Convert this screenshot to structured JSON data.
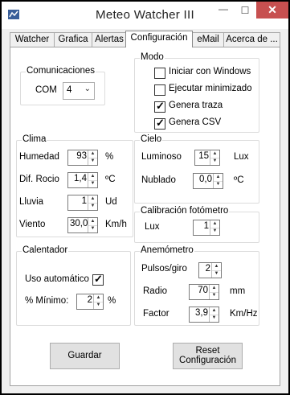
{
  "window": {
    "title": "Meteo Watcher III"
  },
  "tabs": [
    "Watcher",
    "Grafica",
    "Alertas",
    "Configuración",
    "eMail",
    "Acerca de ..."
  ],
  "comunicaciones": {
    "title": "Comunicaciones",
    "label": "COM",
    "value": "4"
  },
  "modo": {
    "title": "Modo",
    "options": [
      {
        "label": "Iniciar con Windows",
        "checked": false
      },
      {
        "label": "Ejecutar minimizado",
        "checked": false
      },
      {
        "label": "Genera traza",
        "checked": true
      },
      {
        "label": "Genera CSV",
        "checked": true
      }
    ]
  },
  "clima": {
    "title": "Clima",
    "rows": [
      {
        "label": "Humedad",
        "value": "93",
        "unit": "%"
      },
      {
        "label": "Dif. Rocio",
        "value": "1,4",
        "unit": "ºC"
      },
      {
        "label": "Lluvia",
        "value": "1",
        "unit": "Ud"
      },
      {
        "label": "Viento",
        "value": "30,0",
        "unit": "Km/h"
      }
    ]
  },
  "cielo": {
    "title": "Cielo",
    "rows": [
      {
        "label": "Luminoso",
        "value": "15",
        "unit": "Lux"
      },
      {
        "label": "Nublado",
        "value": "0,0",
        "unit": "ºC"
      }
    ]
  },
  "calibracion": {
    "title": "Calibración fotómetro",
    "label": "Lux",
    "value": "1"
  },
  "calentador": {
    "title": "Calentador",
    "uso_label": "Uso automático",
    "uso_checked": true,
    "min_label": "% Mínimo:",
    "min_value": "2",
    "min_unit": "%"
  },
  "anemometro": {
    "title": "Anemómetro",
    "rows": [
      {
        "label": "Pulsos/giro",
        "value": "2",
        "unit": ""
      },
      {
        "label": "Radio",
        "value": "70",
        "unit": "mm"
      },
      {
        "label": "Factor",
        "value": "3,9",
        "unit": "Km/Hz"
      }
    ]
  },
  "buttons": {
    "guardar": "Guardar",
    "reset_line1": "Reset",
    "reset_line2": "Configuración"
  }
}
